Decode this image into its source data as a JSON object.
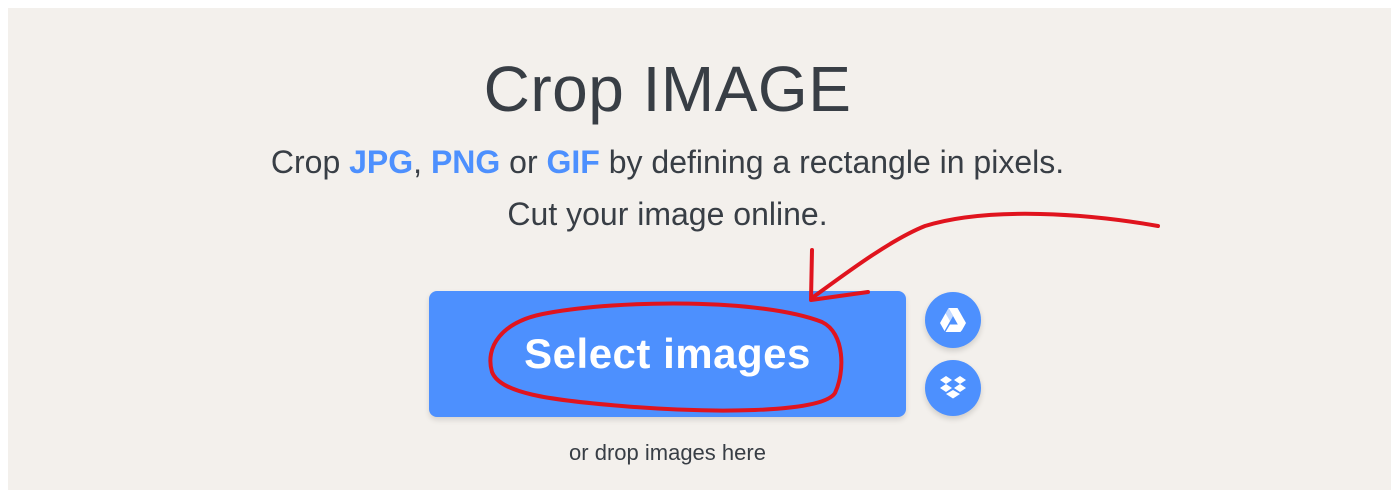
{
  "header": {
    "title": "Crop IMAGE",
    "subtitle": {
      "prefix": "Crop ",
      "format_1": "JPG",
      "sep_1": ", ",
      "format_2": "PNG",
      "sep_2": " or ",
      "format_3": "GIF",
      "line1_rest": " by defining a rectangle in pixels.",
      "line2": "Cut your image online."
    }
  },
  "upload": {
    "select_label": "Select images",
    "drop_hint": "or drop images here",
    "cloud_buttons": [
      {
        "icon": "google-drive-icon"
      },
      {
        "icon": "dropbox-icon"
      }
    ]
  },
  "colors": {
    "accent": "#4d90fe",
    "background": "#f3f0ec",
    "text": "#383e45",
    "annotation": "#e0141e"
  }
}
